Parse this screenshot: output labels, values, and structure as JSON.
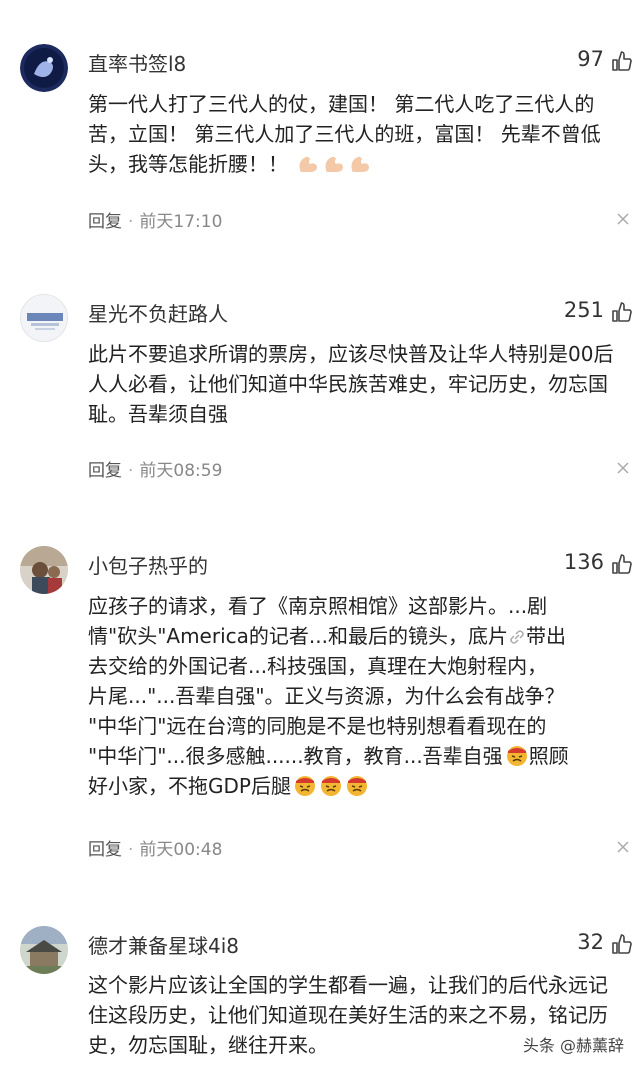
{
  "comments": [
    {
      "username": "直率书签l8",
      "likes": "97",
      "text": "第一代人打了三代人的仗，建国！ 第二代人吃了三代人的苦，立国！ 第三代人加了三代人的班，富国！ 先辈不曾低头，我等怎能折腰！！",
      "emoji": "flexed-biceps",
      "reply": "回复",
      "time": "前天17:10"
    },
    {
      "username": "星光不负赶路人",
      "likes": "251",
      "text": "此片不要追求所谓的票房，应该尽快普及让华人特别是00后人人必看，让他们知道中华民族苦难史，牢记历史，勿忘国耻。吾辈须自强",
      "reply": "回复",
      "time": "前天08:59"
    },
    {
      "username": "小包子热乎的",
      "likes": "136",
      "text_lines": [
        "应孩子的请求，看了《南京照相馆》这部影片。...剧",
        "情\"砍头\"America的记者...和最后的镜头，底片",
        "去交给的外国记者...科技强国，真理在大炮射程内，",
        "片尾...\"...吾辈自强\"。正义与资源，为什么会有战争？",
        "\"中华门\"远在台湾的同胞是不是也特别想看看现在的",
        "\"中华门\"...很多感触......教育，教育...吾辈自强",
        "好小家，不拖GDP后腿"
      ],
      "line2_tail": "带出",
      "line6_tail": "照顾",
      "reply": "回复",
      "time": "前天00:48"
    },
    {
      "username": "德才兼备星球4i8",
      "likes": "32",
      "text": "这个影片应该让全国的学生都看一遍，让我们的后代永远记住这段历史，让他们知道现在美好生活的来之不易，铭记历史，勿忘国耻，继往开来。"
    }
  ],
  "watermark": "头条 @赫薰辞",
  "colors": {
    "text": "#222222",
    "meta": "#888888",
    "emoji_angry": "#f2b632"
  }
}
